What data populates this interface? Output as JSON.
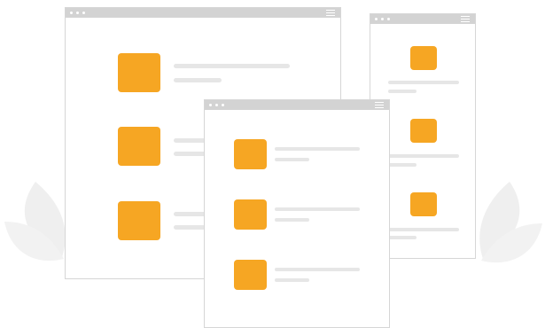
{
  "colors": {
    "accent": "#f6a623",
    "chrome": "#d3d3d3",
    "placeholder_line": "#e6e6e6",
    "window_border": "#d6d6d6",
    "leaf": "#efefef"
  },
  "icons": {
    "window_controls": "three-dots-icon",
    "window_menu": "hamburger-menu-icon",
    "decoration": "leaf-icon"
  }
}
